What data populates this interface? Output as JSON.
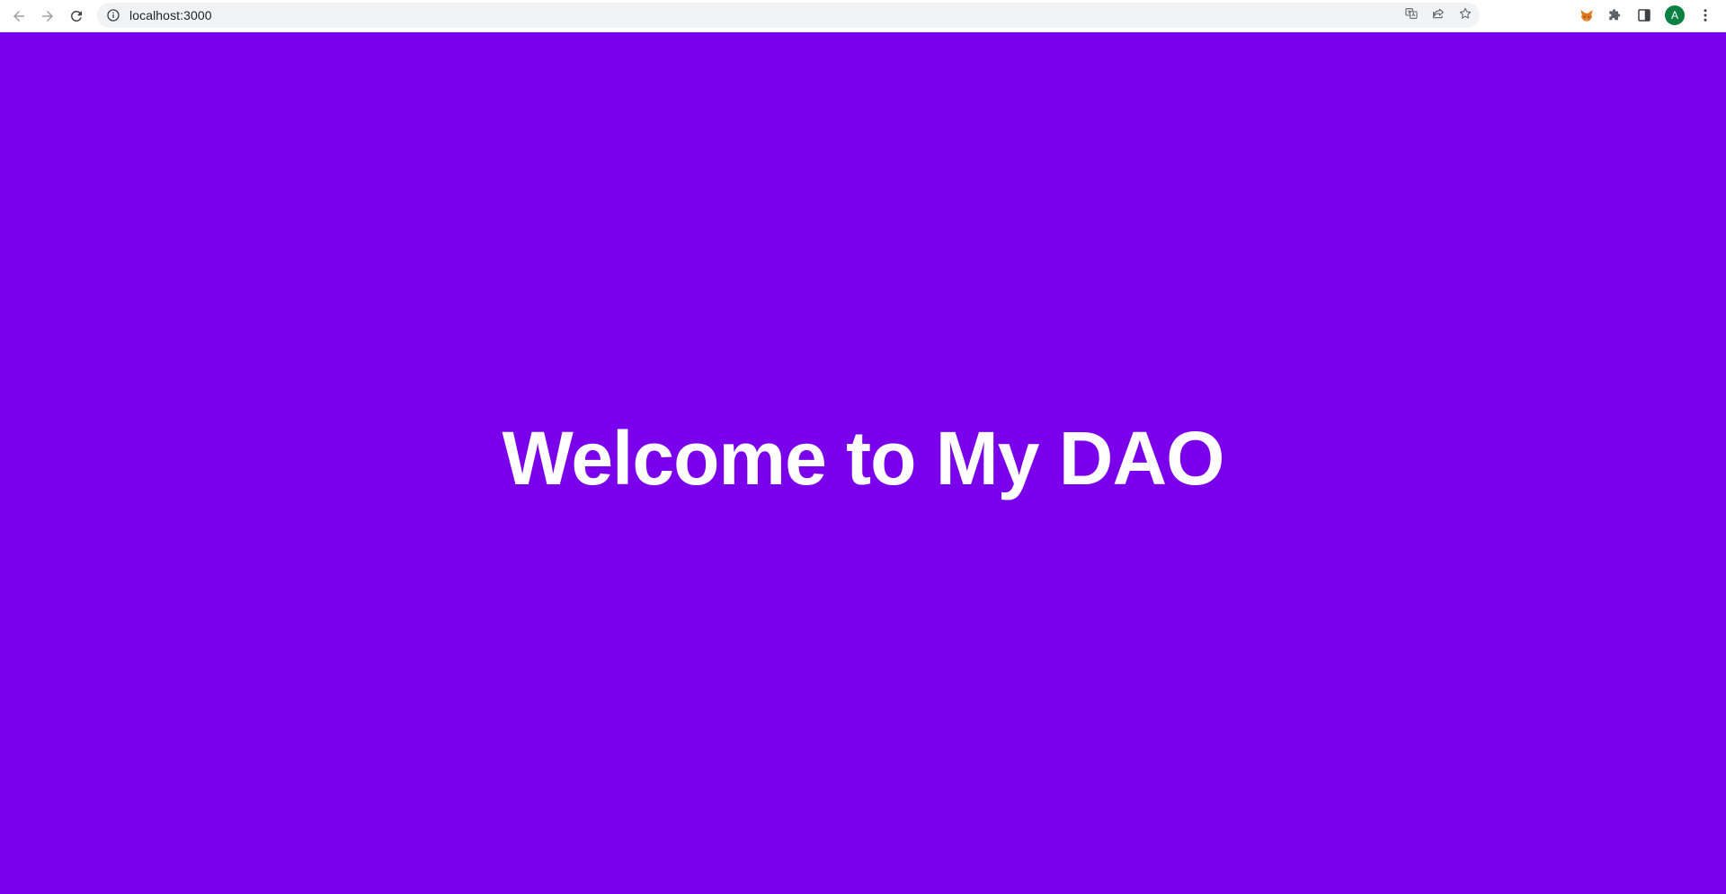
{
  "browser": {
    "url": "localhost:3000",
    "profile_initial": "A",
    "icons": {
      "back": "arrow-left-icon",
      "forward": "arrow-right-icon",
      "reload": "reload-icon",
      "site_info": "info-circle-icon",
      "translate": "translate-icon",
      "share": "share-icon",
      "bookmark": "star-icon",
      "metamask": "fox-icon",
      "extensions": "puzzle-icon",
      "side_panel": "side-panel-icon",
      "menu": "kebab-menu-icon"
    }
  },
  "page": {
    "background_color": "#7a00ec",
    "title": "Welcome to My DAO"
  }
}
